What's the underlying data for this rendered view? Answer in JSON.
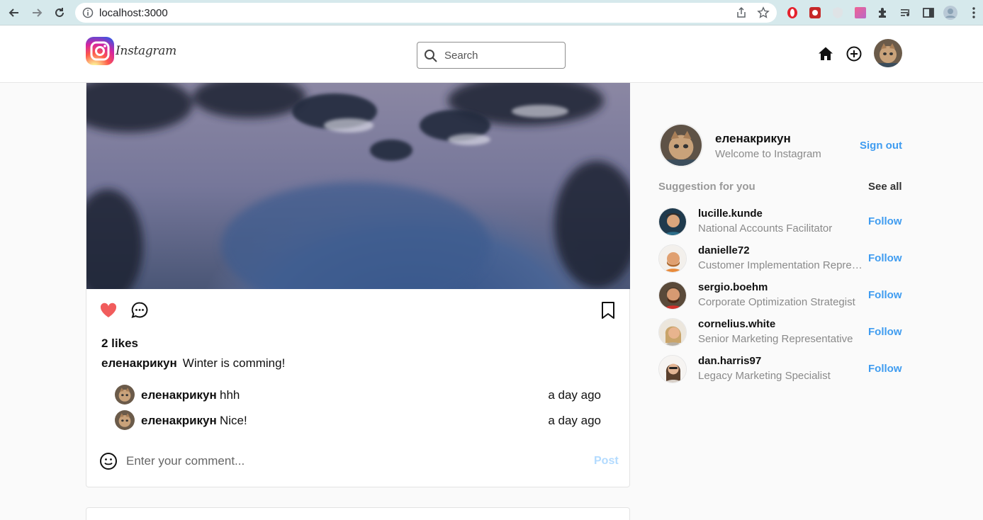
{
  "browser": {
    "url": "localhost:3000"
  },
  "header": {
    "logo_text": "Instagram",
    "search_placeholder": "Search"
  },
  "post": {
    "likes": "2 likes",
    "author": "еленакрикун",
    "caption": "Winter is comming!",
    "comments": [
      {
        "user": "еленакрикун",
        "text": "hhh",
        "time": "a day ago"
      },
      {
        "user": "еленакрикун",
        "text": "Nice!",
        "time": "a day ago"
      }
    ],
    "comment_placeholder": "Enter your comment...",
    "post_label": "Post"
  },
  "sidebar": {
    "username": "еленакрикун",
    "welcome": "Welcome to Instagram",
    "sign_out": "Sign out",
    "suggestion_title": "Suggestion for you",
    "see_all": "See all",
    "suggestions": [
      {
        "name": "lucille.kunde",
        "title": "National Accounts Facilitator",
        "follow": "Follow"
      },
      {
        "name": "danielle72",
        "title": "Customer Implementation Representative",
        "follow": "Follow"
      },
      {
        "name": "sergio.boehm",
        "title": "Corporate Optimization Strategist",
        "follow": "Follow"
      },
      {
        "name": "cornelius.white",
        "title": "Senior Marketing Representative",
        "follow": "Follow"
      },
      {
        "name": "dan.harris97",
        "title": "Legacy Marketing Specialist",
        "follow": "Follow"
      }
    ]
  },
  "colors": {
    "accent": "#3f9cf0",
    "like": "#ed4956",
    "post_disabled": "#b3dbff"
  }
}
